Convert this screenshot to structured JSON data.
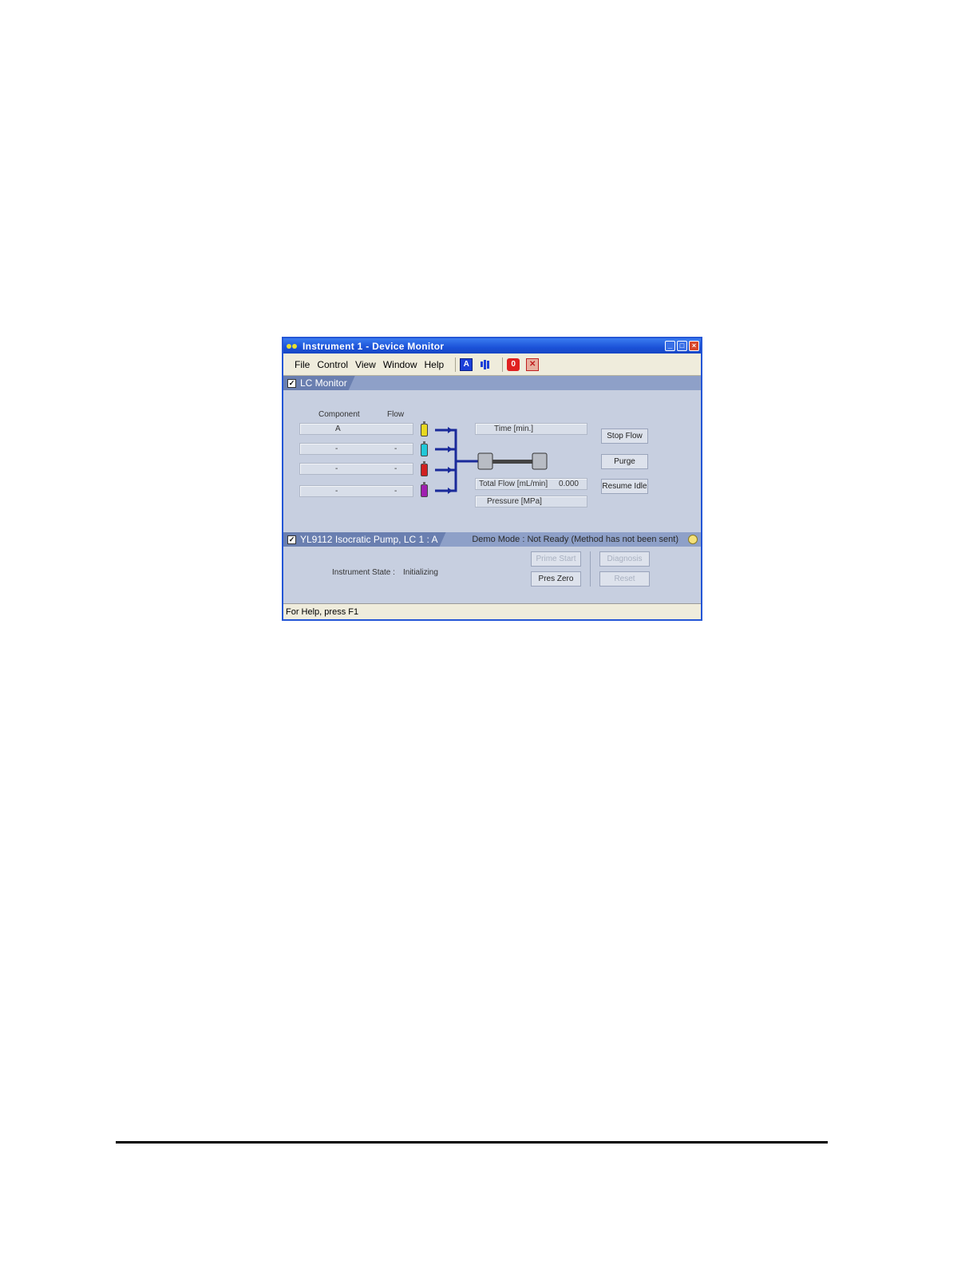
{
  "window": {
    "title": "Instrument 1 - Device Monitor",
    "controls": [
      "_",
      "□",
      "×"
    ]
  },
  "menu": {
    "items": [
      "File",
      "Control",
      "View",
      "Window",
      "Help"
    ],
    "toolbar_icons": [
      "analysis-icon",
      "bar-chart-icon",
      "stop-icon",
      "cancel-icon"
    ]
  },
  "lc_monitor": {
    "tab_label": "LC Monitor",
    "checked": true,
    "component_header": "Component",
    "flow_header": "Flow",
    "rows": [
      {
        "component": "A",
        "flow": ""
      },
      {
        "component": "-",
        "flow": "-"
      },
      {
        "component": "-",
        "flow": "-"
      },
      {
        "component": "-",
        "flow": "-"
      }
    ],
    "bottle_colors": [
      "#e8d820",
      "#20c8d8",
      "#d02020",
      "#a020b0"
    ],
    "time_label": "Time [min.]",
    "time_value": "",
    "total_flow_label": "Total Flow [mL/min]",
    "total_flow_value": "0.000",
    "pressure_label": "Pressure [MPa]",
    "pressure_value": "",
    "buttons": {
      "stop_flow": "Stop Flow",
      "purge": "Purge",
      "resume_idle": "Resume Idle"
    }
  },
  "pump": {
    "tab_label": "YL9112 Isocratic Pump, LC 1 : A",
    "checked": true,
    "status": "Demo Mode : Not Ready (Method has not been sent)",
    "status_color": "#f4e17a",
    "instrument_state_label": "Instrument State :",
    "instrument_state_value": "Initializing",
    "buttons": {
      "prime_start": "Prime Start",
      "pres_zero": "Pres Zero",
      "diagnosis": "Diagnosis",
      "reset": "Reset"
    }
  },
  "statusbar": {
    "text": "For Help, press F1"
  }
}
